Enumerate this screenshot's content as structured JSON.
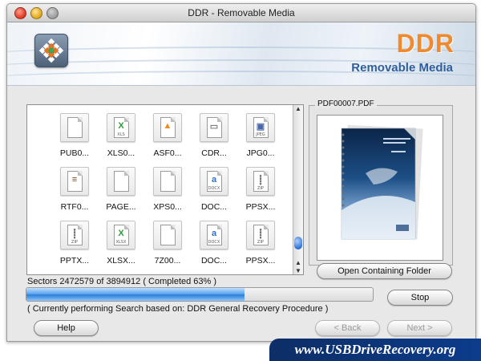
{
  "window": {
    "title": "DDR - Removable Media"
  },
  "header": {
    "brand": "DDR",
    "product": "Removable Media"
  },
  "files": [
    {
      "name": "PUB0...",
      "icon": "blank-file-icon"
    },
    {
      "name": "XLS0...",
      "icon": "excel-file-icon",
      "tag": "XLS",
      "color": "#2e9a3a",
      "glyph": "X"
    },
    {
      "name": "ASF0...",
      "icon": "vlc-file-icon",
      "color": "#f08a1c",
      "glyph": "▲"
    },
    {
      "name": "CDR...",
      "icon": "disk-file-icon",
      "color": "#7b7b7b",
      "glyph": "▭"
    },
    {
      "name": "JPG0...",
      "icon": "jpeg-file-icon",
      "tag": "JPEG",
      "color": "#4a66a8",
      "glyph": "▣"
    },
    {
      "name": "RTF0...",
      "icon": "rtf-file-icon",
      "color": "#7a4a2a",
      "glyph": "≡"
    },
    {
      "name": "PAGE...",
      "icon": "blank-file-icon"
    },
    {
      "name": "XPS0...",
      "icon": "blank-file-icon"
    },
    {
      "name": "DOC...",
      "icon": "docx-file-icon",
      "tag": "DOCX",
      "color": "#2d6fc4",
      "glyph": "a"
    },
    {
      "name": "PPSX...",
      "icon": "zip-file-icon",
      "tag": "ZIP",
      "color": "#777777",
      "glyph": "┋"
    },
    {
      "name": "PPTX...",
      "icon": "zip-file-icon",
      "tag": "ZIP",
      "color": "#777777",
      "glyph": "┋"
    },
    {
      "name": "XLSX...",
      "icon": "xlsx-file-icon",
      "tag": "XLSX",
      "color": "#2e9a3a",
      "glyph": "X"
    },
    {
      "name": "7Z00...",
      "icon": "blank-file-icon"
    },
    {
      "name": "DOC...",
      "icon": "docx-file-icon",
      "tag": "DOCX",
      "color": "#2d6fc4",
      "glyph": "a"
    },
    {
      "name": "PPSX...",
      "icon": "zip-file-icon",
      "tag": "ZIP",
      "color": "#777777",
      "glyph": "┋"
    }
  ],
  "preview": {
    "filename": "PDF00007.PDF",
    "open_folder_label": "Open Containing Folder"
  },
  "progress": {
    "sectors_text": "Sectors 2472579 of 3894912   ( Completed 63% )",
    "percent": 63,
    "status_text": "( Currently performing Search based on: DDR General Recovery Procedure )"
  },
  "buttons": {
    "stop": "Stop",
    "help": "Help",
    "back": "< Back",
    "next": "Next >"
  },
  "watermark": "www.USBDriveRecovery.org",
  "colors": {
    "brand_orange": "#f08a2c",
    "brand_blue": "#2f5f9e",
    "progress_blue": "#2f7fd8"
  }
}
